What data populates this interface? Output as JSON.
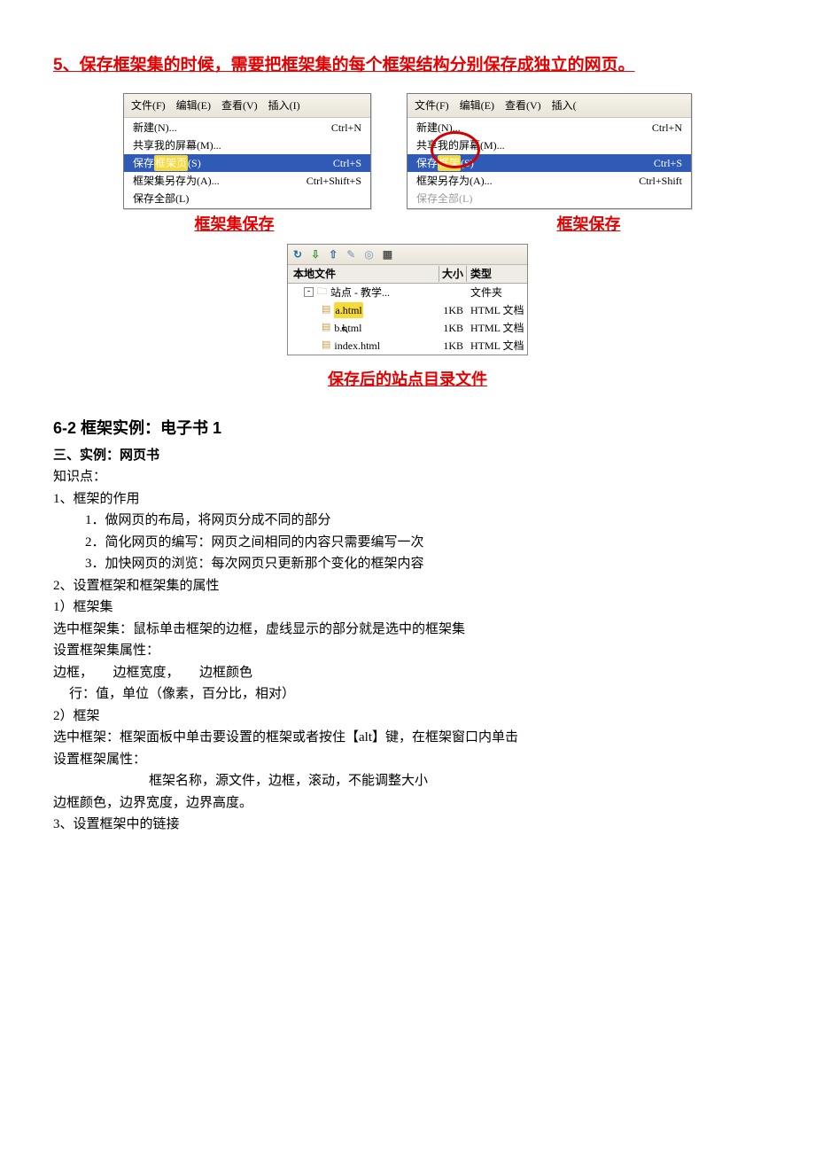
{
  "heading5": "5、保存框架集的时候，需要把框架集的每个框架结构分别保存成独立的网页。",
  "menu_left": {
    "menubar": [
      "文件(F)",
      "编辑(E)",
      "查看(V)",
      "插入(I)"
    ],
    "items": [
      {
        "label": "新建(N)...",
        "shortcut": "Ctrl+N"
      },
      {
        "label": "共享我的屏幕(M)...",
        "shortcut": ""
      },
      {
        "label_pre": "保存",
        "label_hl": "框架页",
        "label_post": "(S)",
        "shortcut": "Ctrl+S",
        "hl": true
      },
      {
        "label": "框架集另存为(A)...",
        "shortcut": "Ctrl+Shift+S"
      },
      {
        "label": "保存全部(L)",
        "shortcut": ""
      }
    ]
  },
  "menu_right": {
    "menubar": [
      "文件(F)",
      "编辑(E)",
      "查看(V)",
      "插入("
    ],
    "items": [
      {
        "label": "新建(N)...",
        "shortcut": "Ctrl+N"
      },
      {
        "label": "共享我的屏幕(M)...",
        "shortcut": ""
      },
      {
        "label_pre": "保存",
        "label_hl": "框架",
        "label_post": "(S)",
        "shortcut": "Ctrl+S",
        "hl": true
      },
      {
        "label": "框架另存为(A)...",
        "shortcut": "Ctrl+Shift"
      },
      {
        "label": "保存全部(L)",
        "shortcut": ""
      }
    ]
  },
  "caption_left": "框架集保存",
  "caption_right": "框架保存",
  "files_panel": {
    "head": {
      "c1": "本地文件",
      "c2": "大小",
      "c3": "类型"
    },
    "rows": [
      {
        "indent": 1,
        "name": "站点 - 教学...",
        "size": "",
        "type": "文件夹",
        "folder": true
      },
      {
        "indent": 2,
        "name": "a.html",
        "size": "1KB",
        "type": "HTML 文档",
        "hl": true
      },
      {
        "indent": 2,
        "name": "b.html",
        "size": "1KB",
        "type": "HTML 文档",
        "cursor": true
      },
      {
        "indent": 2,
        "name": "index.html",
        "size": "1KB",
        "type": "HTML 文档"
      }
    ]
  },
  "caption_files": "保存后的站点目录文件",
  "section_title": "6-2 框架实例：电子书 1",
  "sub_title": "三、实例：网页书",
  "body_lines": [
    "知识点：",
    "1、框架的作用",
    "1．做网页的布局，将网页分成不同的部分",
    "2．简化网页的编写：网页之间相同的内容只需要编写一次",
    "3．加快网页的浏览：每次网页只更新那个变化的框架内容",
    "",
    "2、设置框架和框架集的属性",
    "1）框架集",
    "选中框架集：鼠标单击框架的边框，虚线显示的部分就是选中的框架集",
    "设置框架集属性：",
    "边框，　　边框宽度，　　边框颜色",
    "行：值，单位（像素，百分比，相对）",
    "2）框架",
    "选中框架：框架面板中单击要设置的框架或者按住【alt】键，在框架窗口内单击",
    "设置框架属性：",
    "框架名称，源文件，边框，滚动，不能调整大小",
    "边框颜色，边界宽度，边界高度。",
    "3、设置框架中的链接"
  ]
}
